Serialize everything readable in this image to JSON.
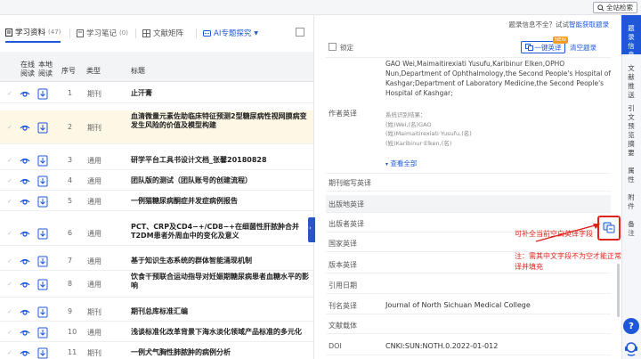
{
  "topbar": {
    "search_label": "全站检索"
  },
  "tabs": [
    {
      "label": "学习资料",
      "count": "(47)"
    },
    {
      "label": "学习笔记",
      "count": "(0)"
    },
    {
      "label": "文献矩阵"
    },
    {
      "label": "AI专题探究"
    }
  ],
  "table": {
    "headers": {
      "online_read": "在线阅读",
      "local_read": "本地阅读",
      "num": "序号",
      "type": "类型",
      "title": "标题"
    },
    "rows": [
      {
        "num": "1",
        "type": "期刊",
        "title": "止汗膏"
      },
      {
        "num": "2",
        "type": "期刊",
        "title": "血清微量元素佐助临床特征预测2型糖尿病性视网膜病变发生风险的价值及模型构建"
      },
      {
        "num": "3",
        "type": "通用",
        "title": "研学平台工具书设计文档_张馨20180828"
      },
      {
        "num": "4",
        "type": "通用",
        "title": "团队版的测试（团队账号的创建流程）"
      },
      {
        "num": "5",
        "type": "通用",
        "title": "一例猫糖尿病酮症并发症病例报告"
      },
      {
        "num": "6",
        "type": "通用",
        "title": "PCT、CRP及CD4−+/CD8−+在细菌性肝脓肿合并T2DM患者外周血中的变化及意义"
      },
      {
        "num": "7",
        "type": "通用",
        "title": "基于知识生态系统的群体智能涌现机制"
      },
      {
        "num": "8",
        "type": "通用",
        "title": "饮食干预联合运动指导对妊娠期糖尿病患者血糖水平的影响"
      },
      {
        "num": "9",
        "type": "期刊",
        "title": "期刊总库标准汇编"
      },
      {
        "num": "10",
        "type": "通用",
        "title": "浅谈标准化改革背景下海水淡化领域产品标准的多元化"
      },
      {
        "num": "11",
        "type": "期刊",
        "title": "一例犬气胸性肺脓肿的病例分析"
      }
    ]
  },
  "panel": {
    "prompt_text": "题录信息不全？试试",
    "prompt_link": "智能获取题录",
    "lock_label": "锁定",
    "translate_label": "一键英译",
    "new_badge": "NEW",
    "clear_label": "清空题录",
    "authors_en_label": "作者英译",
    "authors_en_value": "GAO Wei,Maimaitirexiati Yusufu,Karibinur Elken,OPHO Nun,Department of Ophthalmology,the Second People's Hospital of Kashgar;Department of Laboratory Medicine,the Second People's Hospital of Kashgar;",
    "authors_cn": [
      "系统识别结果：",
      "(姓)Wei,(名)GAO",
      "(姓)Maimaitirexiati·Yusufu,(名)",
      "(姓)Karibinur·Elken,(名)"
    ],
    "view_all": "查看全部",
    "fields": [
      {
        "label": "期刊缩写英译",
        "value": ""
      },
      {
        "label": "出版地英译",
        "value": ""
      },
      {
        "label": "出版者英译",
        "value": ""
      },
      {
        "label": "国家英译",
        "value": ""
      },
      {
        "label": "版本英译",
        "value": ""
      },
      {
        "label": "引用日期",
        "value": ""
      },
      {
        "label": "刊名英译",
        "value": "Journal of North Sichuan Medical College"
      },
      {
        "label": "文献载体",
        "value": ""
      },
      {
        "label": "DOI",
        "value": "CNKI:SUN:NOTH.0.2022-01-012"
      }
    ],
    "annotation1": "可补全当前空白英译字段",
    "annotation2": "注：需其中文字段不为空才能正常翻译并填充"
  },
  "right_nav": [
    {
      "label": "题录信息"
    },
    {
      "label": "文献推送"
    },
    {
      "label": "引文预览"
    },
    {
      "label": "摘要"
    },
    {
      "label": "属性"
    },
    {
      "label": "附件"
    },
    {
      "label": "备注"
    }
  ],
  "help_label": "?",
  "colors": {
    "accent": "#1e57d8",
    "annotation": "#e0231b",
    "selected_row": "#fdf7e6"
  }
}
